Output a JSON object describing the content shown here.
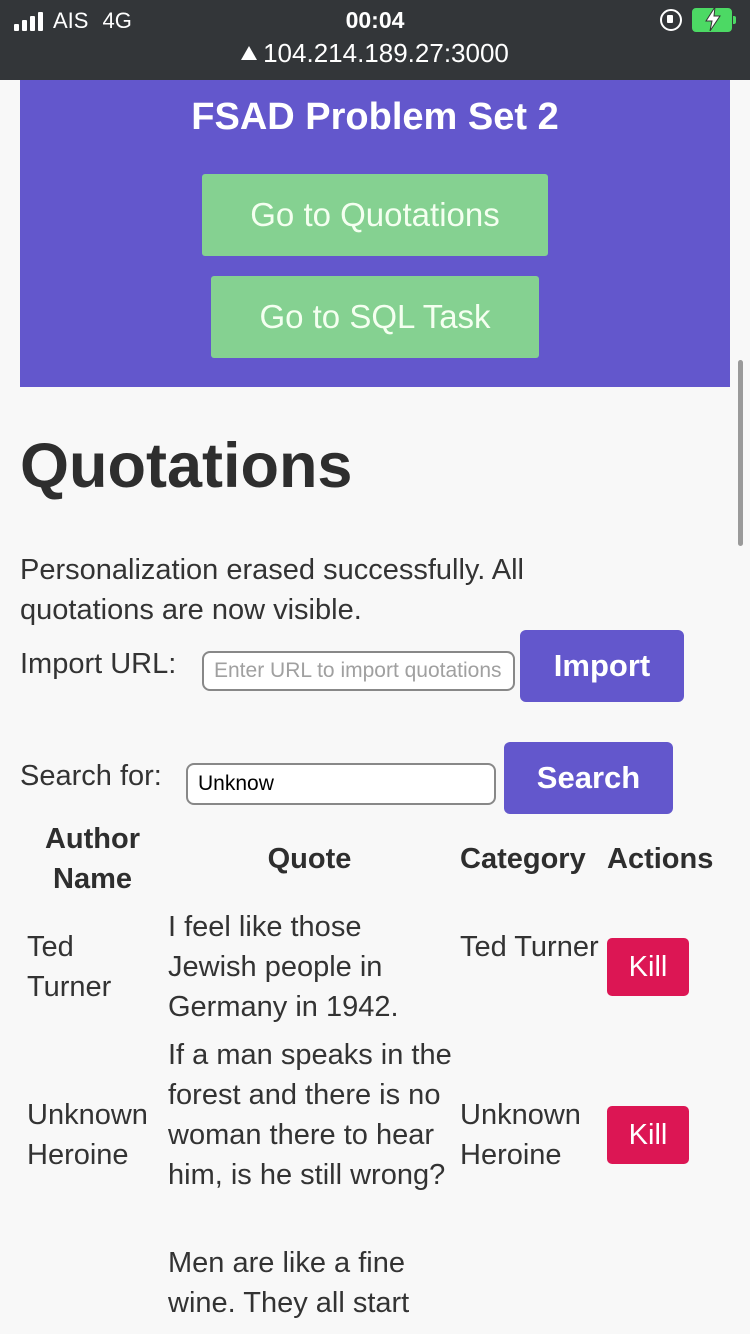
{
  "status_bar": {
    "carrier": "AIS",
    "network": "4G",
    "time": "00:04",
    "url": "104.214.189.27:3000"
  },
  "header": {
    "title": "FSAD Problem Set 2",
    "quotations_button": "Go to Quotations",
    "sql_button": "Go to SQL Task"
  },
  "main": {
    "title": "Quotations",
    "message": "Personalization erased successfully. All quotations are now visible.",
    "import_label": "Import URL:",
    "import_placeholder": "Enter URL to import quotations",
    "import_button": "Import",
    "search_label": "Search for:",
    "search_value": "Unknow",
    "search_button": "Search"
  },
  "table": {
    "headers": [
      "Author Name",
      "Quote",
      "Category",
      "Actions"
    ],
    "rows": [
      {
        "author": "Ted Turner",
        "quote": "I feel like those Jewish people in Germany in 1942.",
        "category": "Ted Turner",
        "action": "Kill"
      },
      {
        "author": "Unknown Heroine",
        "quote": "If a man speaks in the forest and there is no woman there to hear him, is he still wrong?",
        "category": "Unknown Heroine",
        "action": "Kill"
      },
      {
        "author": "",
        "quote": "Men are like a fine wine. They all start",
        "category": "",
        "action": ""
      }
    ]
  }
}
